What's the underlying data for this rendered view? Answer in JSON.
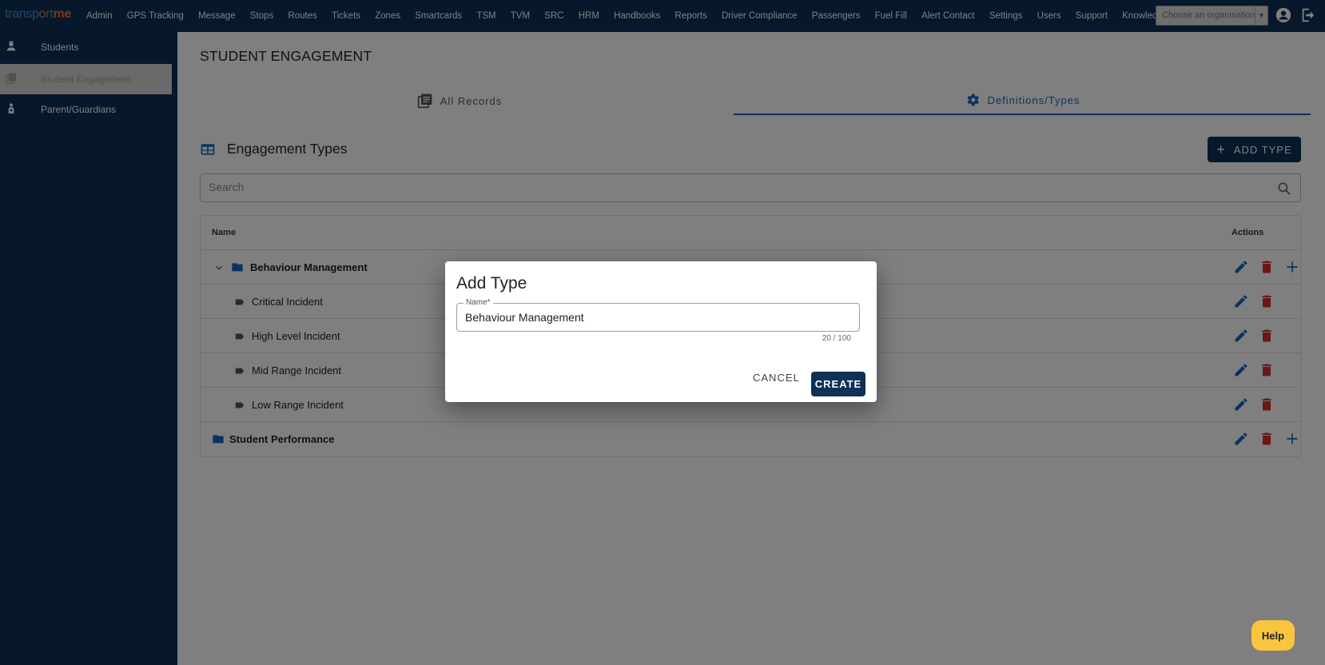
{
  "app": {
    "logo_text_a": "transp",
    "logo_text_b": "rt",
    "logo_text_c": "me"
  },
  "nav": {
    "items": [
      "Admin",
      "GPS Tracking",
      "Message",
      "Stops",
      "Routes",
      "Tickets",
      "Zones",
      "Smartcards",
      "TSM",
      "TVM",
      "SRC",
      "HRM",
      "Handbooks",
      "Reports",
      "Driver Compliance",
      "Passengers",
      "Fuel Fill",
      "Alert Contact",
      "Settings",
      "Users",
      "Support",
      "Knowledge Base"
    ],
    "org_placeholder": "Choose an organisation"
  },
  "sidebar": {
    "items": [
      {
        "label": "Students",
        "icon": "student-icon"
      },
      {
        "label": "Student Engagement",
        "icon": "engagement-icon",
        "active": true
      },
      {
        "label": "Parent/Guardians",
        "icon": "guardian-icon"
      }
    ]
  },
  "page": {
    "title": "STUDENT ENGAGEMENT",
    "tabs": [
      {
        "label": "All Records",
        "icon": "records-icon"
      },
      {
        "label": "Definitions/Types",
        "icon": "gear-icon",
        "active": true
      }
    ],
    "section_title": "Engagement Types",
    "add_button": "ADD TYPE",
    "search_placeholder": "Search"
  },
  "table": {
    "col_name": "Name",
    "col_actions": "Actions",
    "rows": [
      {
        "label": "Behaviour Management",
        "kind": "folder",
        "expanded": true
      },
      {
        "label": "Critical Incident",
        "kind": "type"
      },
      {
        "label": "High Level Incident",
        "kind": "type"
      },
      {
        "label": "Mid Range Incident",
        "kind": "type"
      },
      {
        "label": "Low Range Incident",
        "kind": "type"
      },
      {
        "label": "Student Performance",
        "kind": "folder"
      }
    ]
  },
  "dialog": {
    "title": "Add Type",
    "field_label": "Name*",
    "field_value": "Behaviour Management",
    "counter": "20 / 100",
    "cancel": "CANCEL",
    "create": "CREATE"
  },
  "help": {
    "label": "Help"
  },
  "colors": {
    "navy": "#0f3057",
    "blue": "#1565c0",
    "red": "#d32f2f",
    "help": "#f9c53e",
    "logo_orange": "#ff6d2d"
  }
}
